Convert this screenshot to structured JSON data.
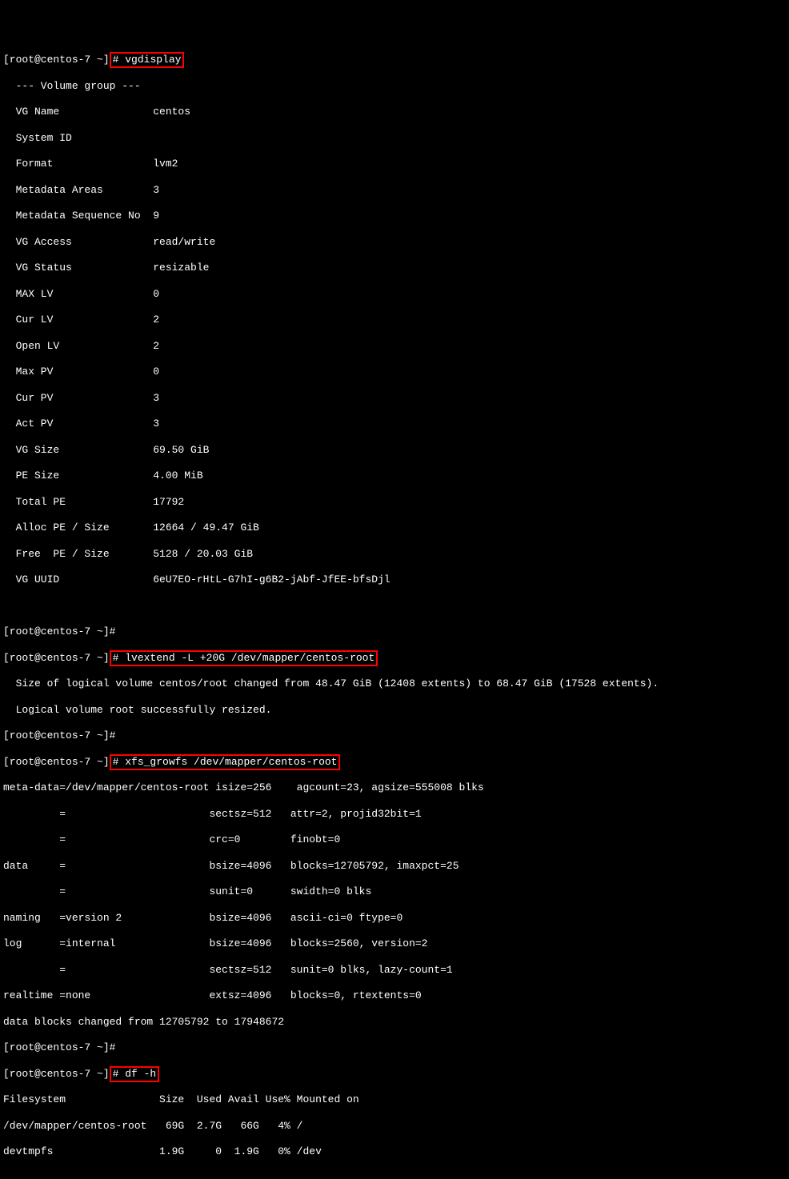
{
  "prompt1": "[root@centos-7 ~]",
  "prompt_hash": "#",
  "cmd1": " vgdisplay",
  "vg_header": "  --- Volume group ---",
  "vg_lines": [
    "  VG Name               centos",
    "  System ID",
    "  Format                lvm2",
    "  Metadata Areas        3",
    "  Metadata Sequence No  9",
    "  VG Access             read/write",
    "  VG Status             resizable",
    "  MAX LV                0",
    "  Cur LV                2",
    "  Open LV               2",
    "  Max PV                0",
    "  Cur PV                3",
    "  Act PV                3",
    "  VG Size               69.50 GiB",
    "  PE Size               4.00 MiB",
    "  Total PE              17792",
    "  Alloc PE / Size       12664 / 49.47 GiB",
    "  Free  PE / Size       5128 / 20.03 GiB",
    "  VG UUID               6eU7EO-rHtL-G7hI-g6B2-jAbf-JfEE-bfsDjl"
  ],
  "blank": " ",
  "prompt2a": "[root@centos-7 ~]#",
  "prompt2b_pre": "[root@centos-7 ~]",
  "cmd2": "# lvextend -L +20G /dev/mapper/centos-root",
  "lvextend_out1": "  Size of logical volume centos/root changed from 48.47 GiB (12408 extents) to 68.47 GiB (17528 extents).",
  "lvextend_out2": "  Logical volume root successfully resized.",
  "prompt3a": "[root@centos-7 ~]#",
  "prompt3b_pre": "[root@centos-7 ~]",
  "cmd3": "# xfs_growfs /dev/mapper/centos-root",
  "xfs_lines": [
    "meta-data=/dev/mapper/centos-root isize=256    agcount=23, agsize=555008 blks",
    "         =                       sectsz=512   attr=2, projid32bit=1",
    "         =                       crc=0        finobt=0",
    "data     =                       bsize=4096   blocks=12705792, imaxpct=25",
    "         =                       sunit=0      swidth=0 blks",
    "naming   =version 2              bsize=4096   ascii-ci=0 ftype=0",
    "log      =internal               bsize=4096   blocks=2560, version=2",
    "         =                       sectsz=512   sunit=0 blks, lazy-count=1",
    "realtime =none                   extsz=4096   blocks=0, rtextents=0",
    "data blocks changed from 12705792 to 17948672"
  ],
  "prompt4a": "[root@centos-7 ~]#",
  "prompt4b_pre": "[root@centos-7 ~]",
  "cmd4": "# df -h",
  "df_lines": [
    "Filesystem               Size  Used Avail Use% Mounted on",
    "/dev/mapper/centos-root   69G  2.7G   66G   4% /",
    "devtmpfs                 1.9G     0  1.9G   0% /dev"
  ]
}
